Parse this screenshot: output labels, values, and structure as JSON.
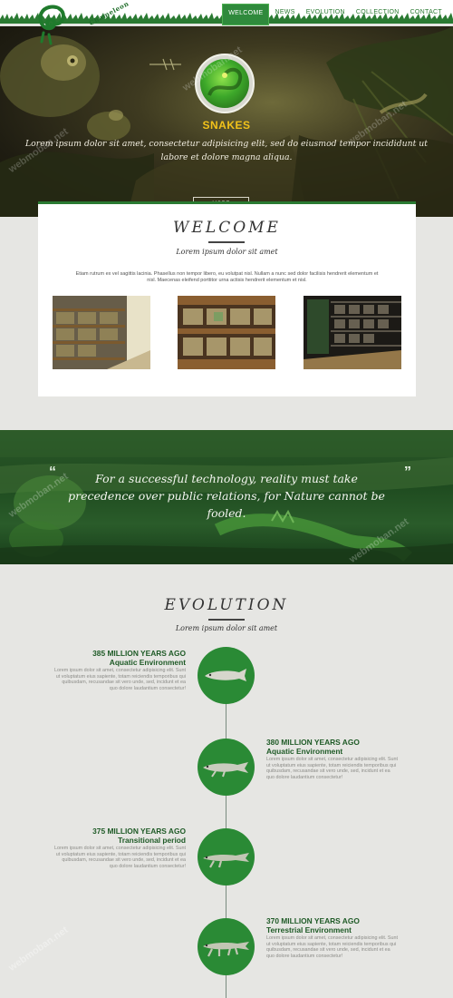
{
  "colors": {
    "brand_green": "#2a7a32",
    "accent_yellow": "#f2c21a",
    "circle_green": "#2a8a35"
  },
  "logo": {
    "icon": "chameleon-icon",
    "text": "Chameleon"
  },
  "nav": {
    "items": [
      {
        "label": "WELCOME",
        "active": true
      },
      {
        "label": "NEWS",
        "active": false
      },
      {
        "label": "EVOLUTION",
        "active": false
      },
      {
        "label": "COLLECTION",
        "active": false
      },
      {
        "label": "CONTACT",
        "active": false
      }
    ]
  },
  "hero": {
    "title": "SNAKES",
    "text": "Lorem ipsum dolor sit amet, consectetur adipisicing elit, sed do eiusmod tempor incididunt ut labore et dolore magna aliqua.",
    "button": "MORE",
    "badge_icon": "snake-icon"
  },
  "welcome": {
    "title": "WELCOME",
    "subtitle": "Lorem ipsum dolor sit amet",
    "body": "Etiam rutrum ex vel sagittis lacinia. Phasellus non tempor libero, eu volutpat nisl. Nullam a nunc sed dolor facilisis hendrerit elementum et nisl. Maecenas eleifend porttitor urna actisis hendrerit elementum et nisl.",
    "gallery": [
      "terrarium-shelves-1",
      "terrarium-shelves-2",
      "terrarium-shelves-3"
    ]
  },
  "quote": {
    "open": "“",
    "close": "”",
    "text": "For a successful technology, reality must take precedence over public relations, for Nature cannot be fooled."
  },
  "evolution": {
    "title": "EVOLUTION",
    "subtitle": "Lorem ipsum dolor sit amet",
    "items": [
      {
        "period": "385 MILLION YEARS AGO",
        "env": "Aquatic Environment",
        "desc": "Lorem ipsum dolor sit amet, consectetur adipisicing elit. Sunt ut voluptatum eius sapiente, totam reiciendis temporibus qui quibusdam, recusandae sit vero unde, sed, incidunt et ea quo dolore laudantium consectetur!",
        "side": "left",
        "icon": "fish-icon"
      },
      {
        "period": "380 MILLION YEARS AGO",
        "env": "Aquatic Environment",
        "desc": "Lorem ipsum dolor sit amet, consectetur adipisicing elit. Sunt ut voluptatum eius sapiente, totam reiciendis temporibus qui quibusdam, recusandae sit vero unde, sed, incidunt et ea quo dolore laudantium consectetur!",
        "side": "right",
        "icon": "lobe-fish-icon"
      },
      {
        "period": "375 MILLION YEARS AGO",
        "env": "Transitional period",
        "desc": "Lorem ipsum dolor sit amet, consectetur adipisicing elit. Sunt ut voluptatum eius sapiente, totam reiciendis temporibus qui quibusdam, recusandae sit vero unde, sed, incidunt et ea quo dolore laudantium consectetur!",
        "side": "left",
        "icon": "tiktaalik-icon"
      },
      {
        "period": "370 MILLION YEARS AGO",
        "env": "Terrestrial Environment",
        "desc": "Lorem ipsum dolor sit amet, consectetur adipisicing elit. Sunt ut voluptatum eius sapiente, totam reiciendis temporibus qui quibusdam, recusandae sit vero unde, sed, incidunt et ea quo dolore laudantium consectetur!",
        "side": "right",
        "icon": "tetrapod-icon"
      }
    ]
  },
  "watermark": "webmoban.net"
}
